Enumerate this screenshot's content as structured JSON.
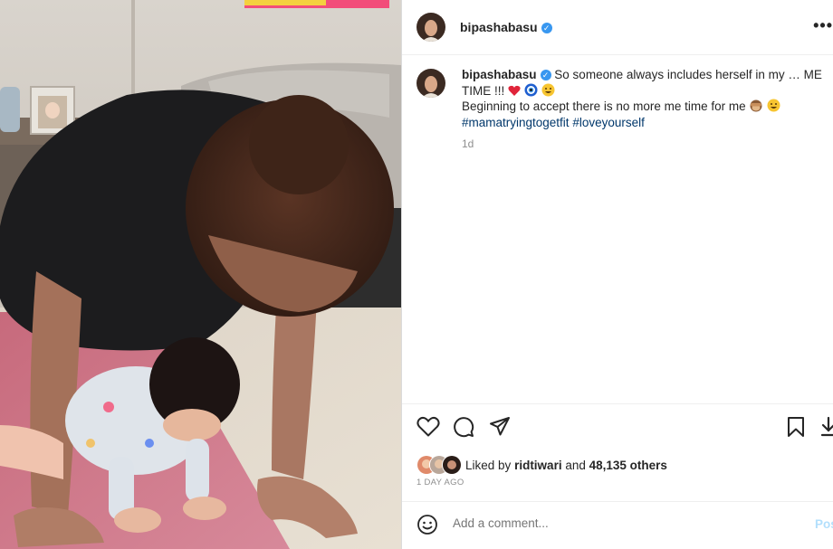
{
  "post": {
    "username": "bipashabasu",
    "verified_mark": "✓",
    "more_glyph": "•••",
    "caption": {
      "username": "bipashabasu",
      "text_line1": "So someone always includes herself in my … ME TIME !!!",
      "text_line2": "Beginning to accept there is no more me time for me",
      "hashtags": [
        "#mamatryingtogetfit",
        "#loveyourself"
      ],
      "time": "1d"
    },
    "icons": {
      "like": "heart-icon",
      "comment": "comment-icon",
      "share": "share-icon",
      "save": "bookmark-icon",
      "download": "download-icon",
      "emoji": "smiley-icon",
      "caption_emojis": [
        "red-heart-emoji",
        "evil-eye-emoji",
        "grinning-face-emoji",
        "see-no-evil-monkey-emoji",
        "grinning-face-emoji"
      ]
    },
    "likes": {
      "prefix": "Liked by",
      "user": "ridtiwari",
      "conj": "and",
      "others": "48,135 others"
    },
    "date": "1 DAY AGO",
    "comment": {
      "placeholder": "Add a comment...",
      "post_label": "Post"
    },
    "colors": {
      "link": "#00376b",
      "verified": "#3897f0",
      "muted": "#8e8e8e",
      "post_disabled": "#b2dffc"
    }
  }
}
